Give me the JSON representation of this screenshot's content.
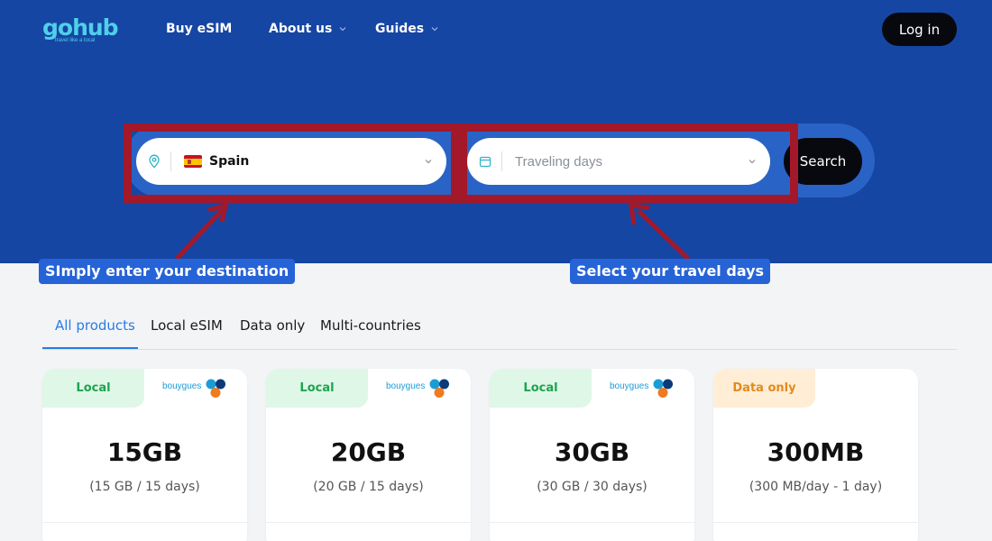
{
  "header": {
    "logo_text": "gohub",
    "logo_tagline": "travel like a local",
    "nav": [
      {
        "label": "Buy eSIM",
        "has_dropdown": false
      },
      {
        "label": "About us",
        "has_dropdown": true
      },
      {
        "label": "Guides",
        "has_dropdown": true
      }
    ],
    "login_label": "Log in"
  },
  "search": {
    "destination_icon": "location-pin-icon",
    "destination_flag": "spain-flag",
    "destination_value": "Spain",
    "days_icon": "calendar-icon",
    "days_placeholder": "Traveling days",
    "search_label": "Search"
  },
  "annotations": {
    "left": "SImply enter your destination",
    "right": "Select your travel days",
    "highlight_color": "#a3192a",
    "callout_color": "#2563d7"
  },
  "tabs": [
    {
      "label": "All products",
      "active": true
    },
    {
      "label": "Local eSIM",
      "active": false
    },
    {
      "label": "Data only",
      "active": false
    },
    {
      "label": "Multi-countries",
      "active": false
    }
  ],
  "products": [
    {
      "badge": "Local",
      "badge_type": "local",
      "operator": "bouygues",
      "amount": "15GB",
      "detail": "(15 GB / 15 days)"
    },
    {
      "badge": "Local",
      "badge_type": "local",
      "operator": "bouygues",
      "amount": "20GB",
      "detail": "(20 GB / 15 days)"
    },
    {
      "badge": "Local",
      "badge_type": "local",
      "operator": "bouygues",
      "amount": "30GB",
      "detail": "(30 GB / 30 days)"
    },
    {
      "badge": "Data only",
      "badge_type": "data",
      "operator": "",
      "amount": "300MB",
      "detail": "(300 MB/day - 1 day)"
    }
  ],
  "colors": {
    "hero": "#1646a3",
    "accent": "#2a7be4",
    "logo": "#4fd0ea"
  }
}
